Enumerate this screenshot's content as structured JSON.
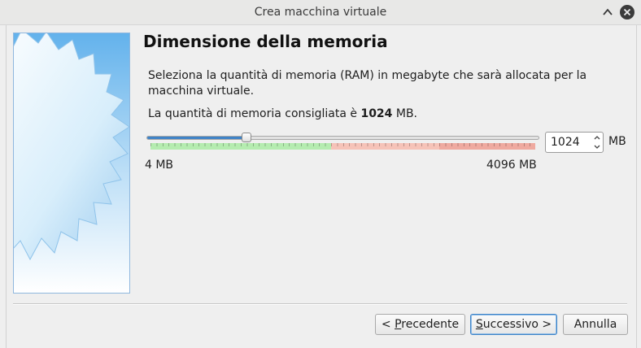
{
  "window": {
    "title": "Crea macchina virtuale"
  },
  "page": {
    "title": "Dimensione della memoria",
    "description": "Seleziona la quantità di memoria (RAM) in megabyte che sarà allocata per la macchina virtuale.",
    "recommend_prefix": "La quantità di memoria consigliata è ",
    "recommend_value": "1024",
    "recommend_suffix": " MB."
  },
  "memory": {
    "min_label": "4 MB",
    "max_label": "4096 MB",
    "min_mb": 4,
    "max_mb": 4096,
    "value_mb": 1024,
    "value_text": "1024",
    "unit": "MB",
    "scale_colors": {
      "ok": "#b5ecb0",
      "warn": "#f6c3b8",
      "danger": "#efaaa0"
    },
    "scale_fractions": {
      "ok_end": 0.47,
      "warn_end": 0.75
    }
  },
  "buttons": {
    "back_prefix": "< ",
    "back_mnemonic": "P",
    "back_rest": "recedente",
    "next_mnemonic": "S",
    "next_rest": "uccessivo >",
    "cancel": "Annulla"
  },
  "colors": {
    "accent": "#3f83c7"
  },
  "icons": {
    "close": "close-icon",
    "minimize": "chevron-up-icon"
  }
}
